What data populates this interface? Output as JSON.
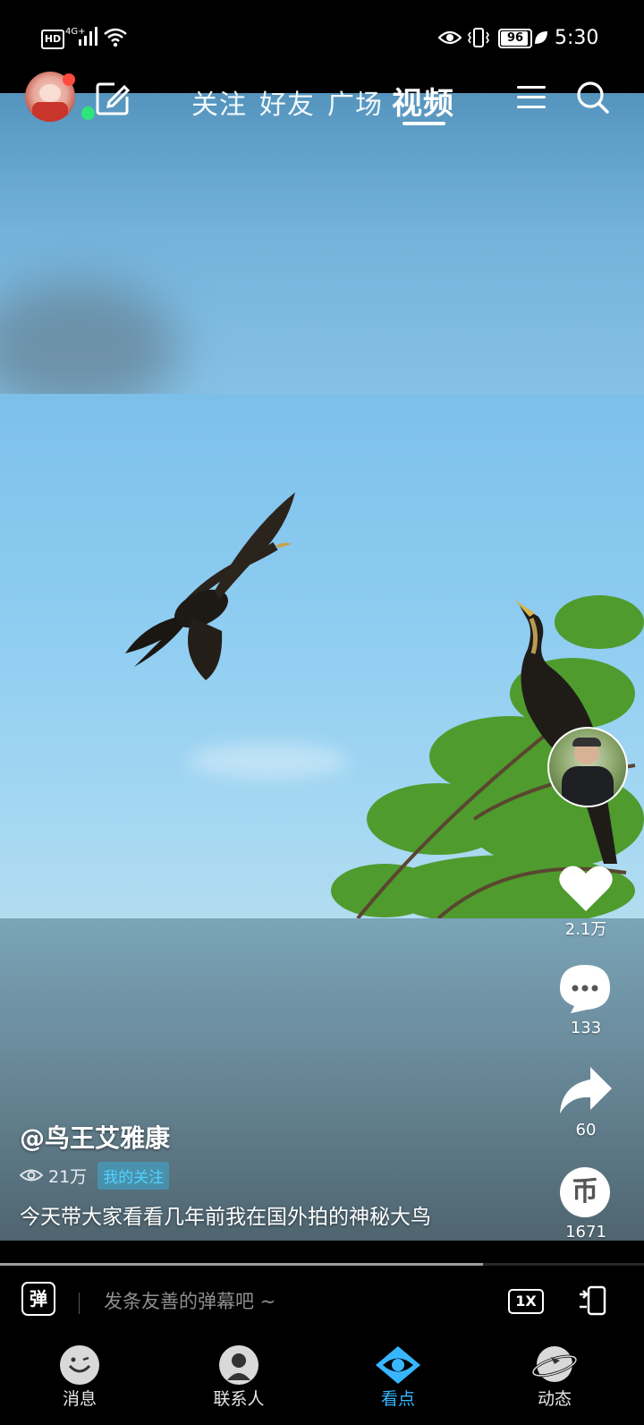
{
  "status_bar": {
    "hd_label": "HD",
    "network": "4G+",
    "battery": "96",
    "time": "5:30"
  },
  "top_nav": {
    "tabs": [
      {
        "label": "关注"
      },
      {
        "label": "好友"
      },
      {
        "label": "广场"
      },
      {
        "label": "视频"
      }
    ],
    "active_tab": "视频"
  },
  "rail": {
    "likes": "2.1万",
    "comments": "133",
    "shares": "60",
    "coins": "1671",
    "coin_glyph": "币"
  },
  "post": {
    "author": "@鸟王艾雅康",
    "views": "21万",
    "follow_tag": "我的关注",
    "caption": "今天带大家看看几年前我在国外拍的神秘大鸟"
  },
  "progress": {
    "fraction": 0.75
  },
  "danmaku": {
    "toggle_glyph": "弹",
    "placeholder": "发条友善的弹幕吧 ~",
    "speed": "1X"
  },
  "bottom_nav": {
    "items": [
      {
        "label": "消息",
        "icon": "message-icon"
      },
      {
        "label": "联系人",
        "icon": "contacts-icon"
      },
      {
        "label": "看点",
        "icon": "eye-icon"
      },
      {
        "label": "动态",
        "icon": "planet-icon"
      }
    ],
    "active": "看点"
  },
  "colors": {
    "accent": "#37b6ff",
    "follow_tag_text": "#51d2ff",
    "online_dot": "#2ee57a",
    "notification_dot": "#ff4b3e"
  }
}
